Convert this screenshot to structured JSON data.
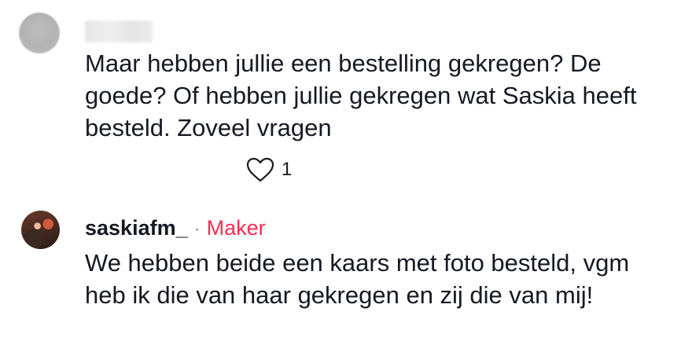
{
  "comments": [
    {
      "author": "",
      "author_blurred": true,
      "text": "Maar hebben jullie een bestelling gekregen? De\ngoede? Of hebben jullie gekregen wat Saskia heeft\nbesteld. Zoveel vragen",
      "like_count": "1",
      "like_icon": "heart-outline-icon"
    },
    {
      "author": "saskiafm_",
      "separator": "·",
      "badge": "Maker",
      "text": "We hebben beide een kaars met foto besteld, vgm\nheb ik die van haar gekregen en zij die van mij!"
    }
  ],
  "colors": {
    "text": "#161823",
    "badge": "#fe2c55",
    "muted": "#8a8b91"
  }
}
